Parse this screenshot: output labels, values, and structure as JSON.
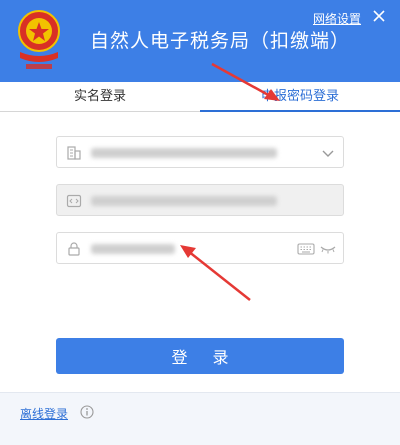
{
  "header": {
    "title": "自然人电子税务局（扣缴端）",
    "network_settings": "网络设置",
    "colors": {
      "brand": "#3d7fe6",
      "emblem_red": "#d93025",
      "emblem_gold": "#f2c200"
    }
  },
  "tabs": [
    {
      "label": "实名登录",
      "active": false
    },
    {
      "label": "申报密码登录",
      "active": true
    }
  ],
  "form": {
    "org_field": {
      "icon": "building-icon"
    },
    "user_field": {
      "icon": "code-icon"
    },
    "password_field": {
      "icon": "lock-icon"
    }
  },
  "login_button": {
    "label": "登 录"
  },
  "footer": {
    "offline_login": "离线登录"
  },
  "annotation_color": "#e53935"
}
